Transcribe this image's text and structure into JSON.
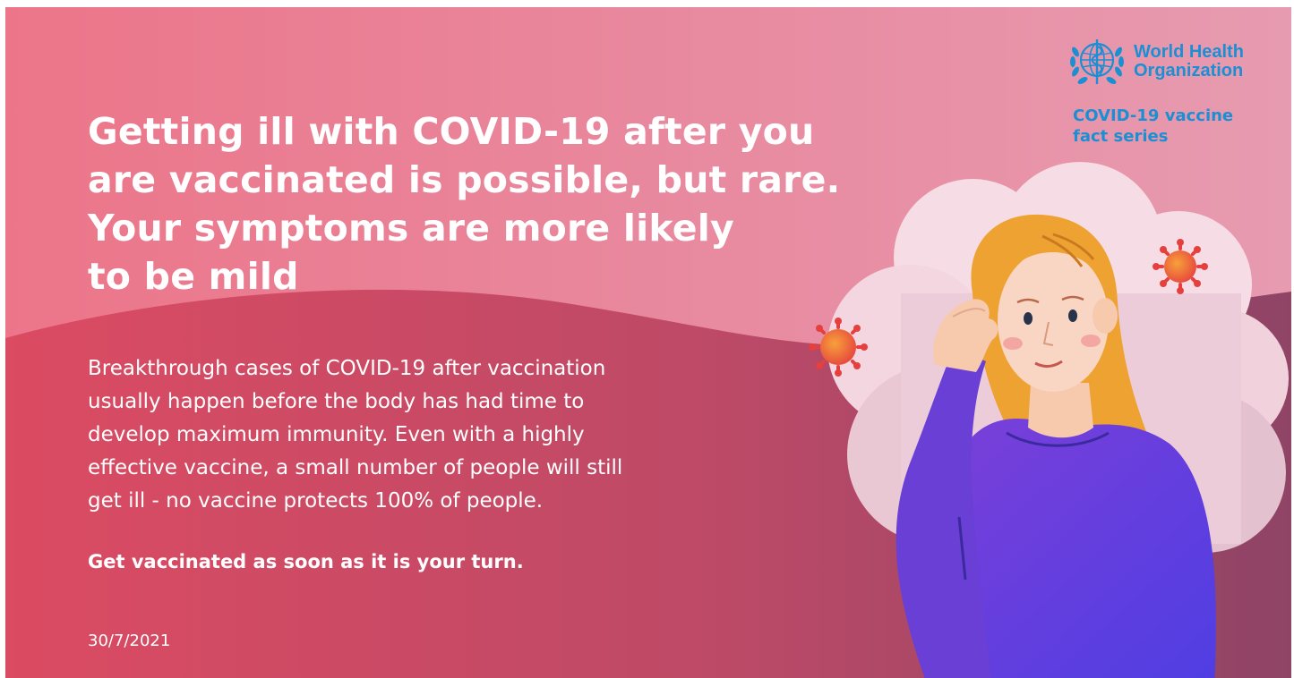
{
  "headline": [
    "Getting ill with COVID-19 after you",
    "are vaccinated is possible, but rare.",
    "Your symptoms are more likely",
    "to be mild"
  ],
  "body": [
    "Breakthrough cases of COVID-19 after vaccination",
    "usually happen before the body has had time to",
    "develop maximum immunity. Even with a highly",
    "effective vaccine, a small number of people will still",
    "get ill - no vaccine protects 100% of people."
  ],
  "cta": "Get vaccinated as soon as it is your turn.",
  "date": "30/7/2021",
  "brand": {
    "name_line1": "World Health",
    "name_line2": "Organization",
    "series_line1": "COVID-19 vaccine",
    "series_line2": "fact series"
  },
  "colors": {
    "brand_blue": "#1b8fd4",
    "text": "#ffffff",
    "top_pink": "#ec7589",
    "lower_red": "#d94d64",
    "lower_plum": "#9a4667",
    "sweater": "#6a3fd6",
    "hair": "#eea232",
    "virus": "#e8453c"
  },
  "icons": [
    "who-emblem-icon",
    "virus-icon"
  ]
}
